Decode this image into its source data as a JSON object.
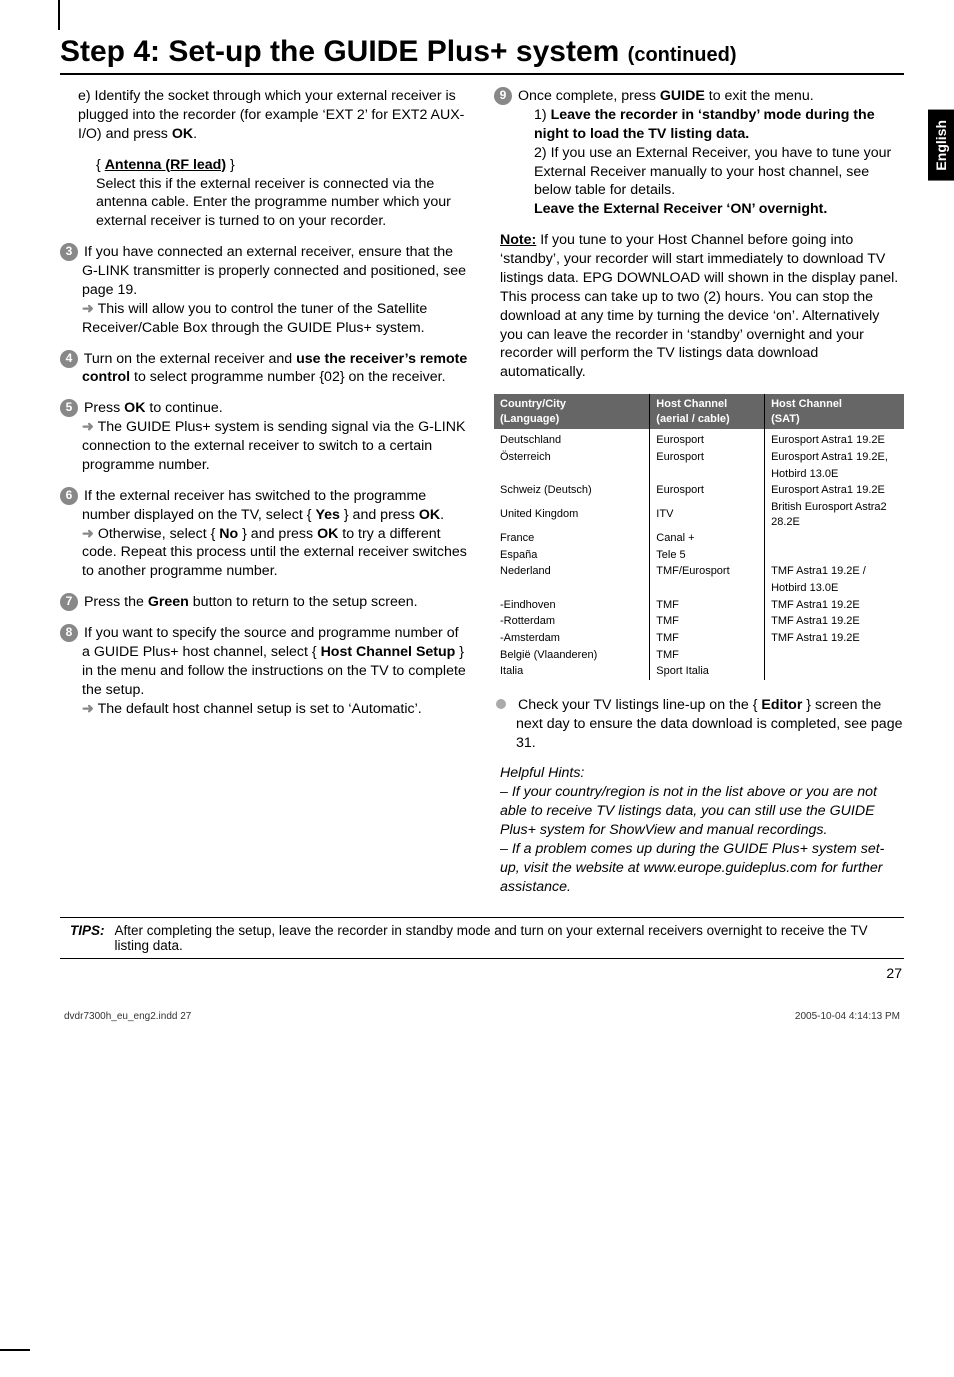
{
  "sideTab": "English",
  "title": "Step 4: Set-up the GUIDE Plus+ system",
  "titleCont": "(continued)",
  "colLeft": {
    "e": {
      "lead": "e) Identify the socket through which your external receiver is plugged into the recorder (for example ‘EXT 2’ for EXT2 AUX-I/O) and press ",
      "ok": "OK",
      "period": "."
    },
    "antenna": {
      "heading": "Antenna (RF lead)",
      "text": "Select this if the external receiver is connected via the antenna cable. Enter the programme number which your external receiver is turned to on your recorder."
    },
    "s3": {
      "num": "3",
      "text": "If you have connected an external receiver, ensure that the G-LINK transmitter is properly connected and positioned, see page 19.",
      "sub": " This will allow you to control the tuner of the Satellite Receiver/Cable Box through the GUIDE Plus+ system."
    },
    "s4": {
      "num": "4",
      "pre": "Turn on the external receiver and ",
      "bold": "use the receiver’s remote control",
      "post": " to select programme number {02} on the receiver."
    },
    "s5": {
      "num": "5",
      "pre": "Press ",
      "ok": "OK",
      "post": " to continue.",
      "sub": " The GUIDE Plus+ system is sending signal via the G-LINK connection to the external receiver to switch to a certain programme number."
    },
    "s6": {
      "num": "6",
      "text1": "If the external receiver has switched to the programme number displayed on the TV, select { ",
      "yes": "Yes",
      "text2": " } and press ",
      "ok": "OK",
      "p": ".",
      "arrowtext1": " Otherwise, select { ",
      "no": "No",
      "arrowtext2": " } and press ",
      "ok2": "OK",
      "arrowtext3": " to try a different code. Repeat this process until the external receiver switches to another programme number."
    },
    "s7": {
      "num": "7",
      "pre": "Press the ",
      "green": "Green",
      "post": " button to return to the setup screen."
    },
    "s8": {
      "num": "8",
      "pre": "If you want to specify the source and programme number of a GUIDE Plus+ host channel, select { ",
      "bold": "Host Channel Setup",
      "post": " } in the menu and follow the instructions on the TV to complete the setup.",
      "sub": " The default host channel setup is set to ‘Automatic’."
    }
  },
  "colRight": {
    "s9": {
      "num": "9",
      "pre": "Once complete, press ",
      "guide": "GUIDE",
      "post": " to exit the menu.",
      "i1bold": "Leave the recorder in ‘standby’ mode during the night to load the TV listing data.",
      "i2pre": "If you use an External Receiver, you have to tune your External Receiver manually to your host channel, see below table for details.",
      "i2bold": "Leave the External Receiver ‘ON’ overnight."
    },
    "note": {
      "head": "Note:",
      "body": " If you tune to your Host Channel before going into ‘standby’, your recorder will start immediately to download TV listings data. EPG DOWNLOAD will shown in the display panel. This process can take up to two (2) hours. You can stop the download at any time by turning the device ‘on’. Alternatively you can leave the recorder in ‘standby’ overnight and your recorder will perform the TV listings data download automatically."
    },
    "tableHeaders": {
      "c1a": "Country/City",
      "c1b": "(Language)",
      "c2a": "Host Channel",
      "c2b": "(aerial / cable)",
      "c3a": "Host Channel",
      "c3b": "(SAT)"
    },
    "tableRows": [
      {
        "c1": "Deutschland",
        "c2": "Eurosport",
        "c3": "Eurosport Astra1 19.2E"
      },
      {
        "c1": "Österreich",
        "c2": "Eurosport",
        "c3": "Eurosport Astra1 19.2E,"
      },
      {
        "c1": "",
        "c2": "",
        "c3": "Hotbird 13.0E"
      },
      {
        "c1": "Schweiz (Deutsch)",
        "c2": "Eurosport",
        "c3": "Eurosport Astra1 19.2E"
      },
      {
        "c1": "United Kingdom",
        "c2": "ITV",
        "c3": "British Eurosport Astra2 28.2E"
      },
      {
        "c1": "France",
        "c2": "Canal +",
        "c3": ""
      },
      {
        "c1": "España",
        "c2": "Tele 5",
        "c3": ""
      },
      {
        "c1": "Nederland",
        "c2": "TMF/Eurosport",
        "c3": "TMF Astra1 19.2E /"
      },
      {
        "c1": "",
        "c2": "",
        "c3": "Hotbird 13.0E"
      },
      {
        "c1": "-Eindhoven",
        "c2": "TMF",
        "c3": "TMF Astra1 19.2E"
      },
      {
        "c1": "-Rotterdam",
        "c2": "TMF",
        "c3": "TMF Astra1 19.2E"
      },
      {
        "c1": "-Amsterdam",
        "c2": "TMF",
        "c3": "TMF Astra1 19.2E"
      },
      {
        "c1": "België (Vlaanderen)",
        "c2": "TMF",
        "c3": ""
      },
      {
        "c1": "Italia",
        "c2": "Sport Italia",
        "c3": ""
      }
    ],
    "check": {
      "pre": "Check your TV listings line-up on the { ",
      "bold": "Editor",
      "post": " } screen the next day to ensure the data download is completed, see page 31."
    },
    "hints": {
      "head": "Helpful Hints:",
      "l1": "– If your country/region is not in the list above or you are not able to receive TV listings data, you can still use the GUIDE Plus+ system for ShowView and manual recordings.",
      "l2": "– If a problem comes up during the GUIDE Plus+ system set-up, visit the website at www.europe.guideplus.com for further assistance."
    }
  },
  "tipsLabel": "TIPS:",
  "tipsText": "After completing the setup, leave the recorder in standby mode and turn on your external receivers overnight to receive the TV listing data.",
  "pageNum": "27",
  "footerLeft": "dvdr7300h_eu_eng2.indd   27",
  "footerRight": "2005-10-04   4:14:13 PM"
}
